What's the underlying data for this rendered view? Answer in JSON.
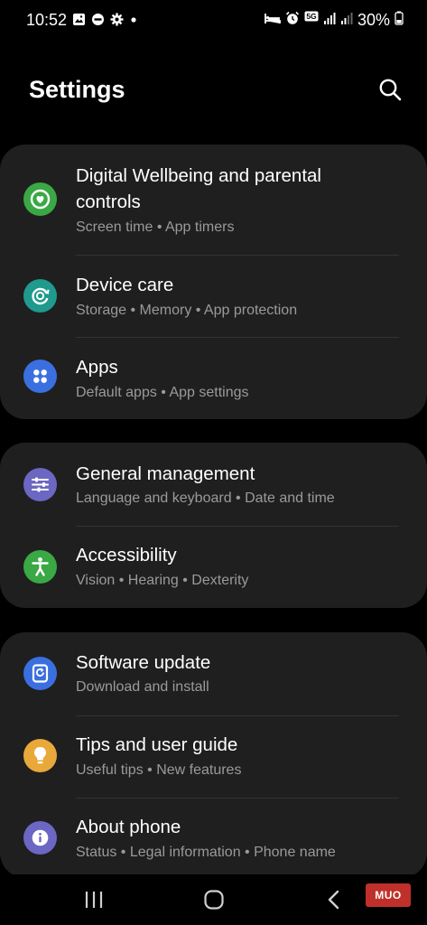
{
  "status_bar": {
    "time": "10:52",
    "battery": "30%",
    "network": "5G",
    "left_icons": [
      "image-icon",
      "do-not-disturb-icon",
      "gear-icon",
      "dot-icon"
    ],
    "right_icons": [
      "bed-icon",
      "alarm-icon",
      "5g-icon",
      "signal-icon",
      "signal-icon",
      "battery-icon"
    ]
  },
  "header": {
    "title": "Settings",
    "search_icon": "search-icon"
  },
  "sections": [
    {
      "items": [
        {
          "title_line1": "Digital Wellbeing and parental",
          "title_line2": "controls",
          "subtitle": "Screen time  •  App timers",
          "icon": "digital-wellbeing-icon",
          "color": "#3aa845"
        },
        {
          "title": "Device care",
          "subtitle": "Storage  •  Memory  •  App protection",
          "icon": "device-care-icon",
          "color": "#1f9a8c"
        },
        {
          "title": "Apps",
          "subtitle": "Default apps  •  App settings",
          "icon": "apps-icon",
          "color": "#3b6fe0"
        }
      ]
    },
    {
      "items": [
        {
          "title": "General management",
          "subtitle": "Language and keyboard  •  Date and time",
          "icon": "general-management-icon",
          "color": "#6b67c2"
        },
        {
          "title": "Accessibility",
          "subtitle": "Vision  •  Hearing  •  Dexterity",
          "icon": "accessibility-icon",
          "color": "#3aa845"
        }
      ]
    },
    {
      "items": [
        {
          "title": "Software update",
          "subtitle": "Download and install",
          "icon": "software-update-icon",
          "color": "#3b6fe0"
        },
        {
          "title": "Tips and user guide",
          "subtitle": "Useful tips  •  New features",
          "icon": "lightbulb-icon",
          "color": "#e8a93a"
        },
        {
          "title": "About phone",
          "subtitle": "Status  •  Legal information  •  Phone name",
          "icon": "info-icon",
          "color": "#6b67c2"
        }
      ]
    }
  ],
  "nav_bar": {
    "recents_icon": "recents-icon",
    "home_icon": "home-icon",
    "back_icon": "back-icon"
  },
  "watermark": "MUO"
}
